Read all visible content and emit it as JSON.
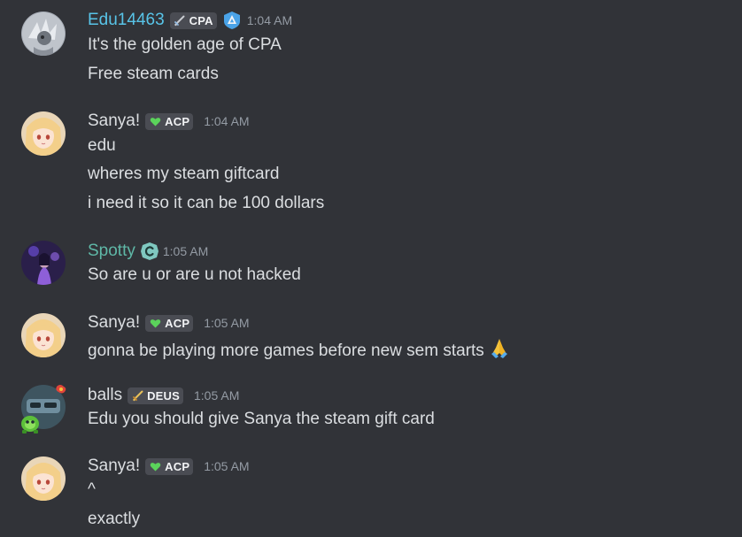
{
  "messages": [
    {
      "author": "Edu14463",
      "author_color": "#58c4e8",
      "tag": "CPA",
      "tag_icon": "sword-icon",
      "badge_icon": "triangle-shield-icon",
      "time": "1:04 AM",
      "lines": [
        "It's the golden age of CPA",
        "Free steam cards"
      ]
    },
    {
      "author": "Sanya!",
      "author_color": "#dbdee1",
      "tag": "ACP",
      "tag_icon": "green-heart-icon",
      "time": "1:04 AM",
      "lines": [
        "edu",
        "wheres my steam giftcard",
        "i need it so it can be 100 dollars"
      ]
    },
    {
      "author": "Spotty",
      "author_color": "#5fb8a7",
      "badge_icon": "c-badge-icon",
      "time": "1:05 AM",
      "lines": [
        "So are u or are u not hacked"
      ]
    },
    {
      "author": "Sanya!",
      "author_color": "#dbdee1",
      "tag": "ACP",
      "tag_icon": "green-heart-icon",
      "time": "1:05 AM",
      "lines": [
        "gonna be playing more games before new sem starts"
      ],
      "trailing_emoji": "folded-hands-emoji"
    },
    {
      "author": "balls",
      "author_color": "#dbdee1",
      "tag": "DEUS",
      "tag_icon": "sword-icon",
      "time": "1:05 AM",
      "lines": [
        "Edu you should give Sanya the steam gift card"
      ]
    },
    {
      "author": "Sanya!",
      "author_color": "#dbdee1",
      "tag": "ACP",
      "tag_icon": "green-heart-icon",
      "time": "1:05 AM",
      "lines": [
        "^",
        "exactly"
      ]
    }
  ]
}
